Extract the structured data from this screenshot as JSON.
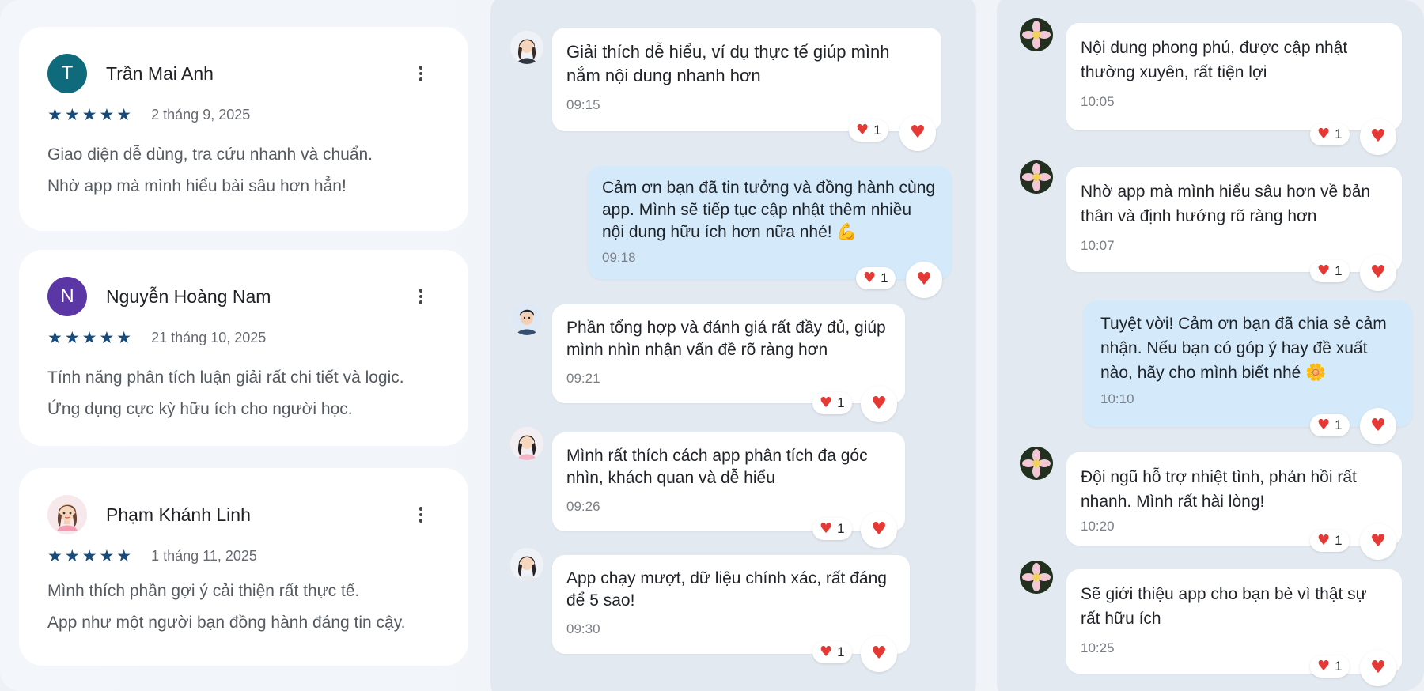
{
  "reviews": [
    {
      "initial": "T",
      "avatar_color": "#0f6b7c",
      "name": "Trần Mai Anh",
      "stars": "★★★★★",
      "date": "2 tháng 9, 2025",
      "line1": "Giao diện dễ dùng, tra cứu nhanh và chuẩn.",
      "line2": "Nhờ app mà mình hiểu bài sâu hơn hẳn!"
    },
    {
      "initial": "N",
      "avatar_color": "#5b37a6",
      "name": "Nguyễn Hoàng Nam",
      "stars": "★★★★★",
      "date": "21 tháng 10, 2025",
      "line1": "Tính năng phân tích luận giải rất chi tiết và logic.",
      "line2": "Ứng dụng cực kỳ hữu ích cho người học."
    },
    {
      "name": "Phạm Khánh Linh",
      "stars": "★★★★★",
      "date": "1 tháng 11, 2025",
      "line1": "Mình thích phần gợi ý cải thiện rất thực tế.",
      "line2": "App như một người bạn đồng hành đáng tin cậy."
    }
  ],
  "chat_left": [
    {
      "text": "Giải thích dễ hiểu, ví dụ thực tế giúp mình nắm nội dung nhanh hơn",
      "time": "09:15",
      "count": "1"
    },
    {
      "text": "Cảm ơn bạn đã tin tưởng và đồng hành cùng app. Mình sẽ tiếp tục cập nhật thêm nhiều nội dung hữu ích hơn nữa nhé! 💪",
      "time": "09:18",
      "count": "1"
    },
    {
      "text": "Phần tổng hợp và đánh giá rất đầy đủ, giúp mình nhìn nhận vấn đề rõ ràng hơn",
      "time": "09:21",
      "count": "1"
    },
    {
      "text": "Mình rất thích cách app phân tích đa góc nhìn, khách quan và dễ hiểu",
      "time": "09:26",
      "count": "1"
    },
    {
      "text": "App chạy mượt, dữ liệu chính xác, rất đáng để 5 sao!",
      "time": "09:30",
      "count": "1"
    }
  ],
  "chat_right": [
    {
      "text": "Nội dung phong phú, được cập nhật thường xuyên, rất tiện lợi",
      "time": "10:05",
      "count": "1"
    },
    {
      "text": "Nhờ app mà mình hiểu sâu hơn về bản thân và định hướng rõ ràng hơn",
      "time": "10:07",
      "count": "1"
    },
    {
      "text": "Tuyệt vời! Cảm ơn bạn đã chia sẻ cảm nhận. Nếu bạn có góp ý hay đề xuất nào, hãy cho mình biết nhé 🌼",
      "time": "10:10",
      "count": "1"
    },
    {
      "text": "Đội ngũ hỗ trợ nhiệt tình, phản hồi rất nhanh. Mình rất hài lòng!",
      "time": "10:20",
      "count": "1"
    },
    {
      "text": "Sẽ giới thiệu app cho bạn bè vì thật sự rất hữu ích",
      "time": "10:25",
      "count": "1"
    }
  ],
  "icons": {
    "star": "star-icon",
    "heart": "heart-icon",
    "menu": "more-vert-icon"
  },
  "colors": {
    "star": "#174b7b",
    "heart": "#e53935",
    "reply_bubble": "#d4eafb"
  }
}
